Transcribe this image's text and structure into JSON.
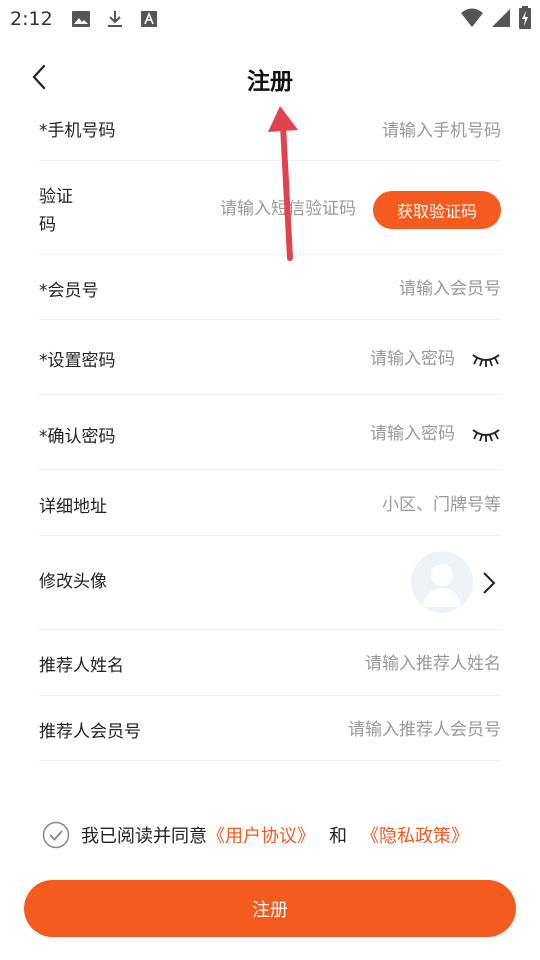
{
  "status_bar": {
    "time": "2:12",
    "left_icons": [
      "image-icon",
      "download-icon",
      "font-icon"
    ],
    "right_icons": [
      "wifi-icon",
      "signal-icon",
      "battery-charging-icon"
    ]
  },
  "header": {
    "title": "注册"
  },
  "form": {
    "phone": {
      "label": "*手机号码",
      "placeholder": "请输入手机号码"
    },
    "sms_code": {
      "label_line1": "验证",
      "label_line2": "码",
      "placeholder": "请输入短信验证码",
      "button": "获取验证码"
    },
    "member_no": {
      "label": "*会员号",
      "placeholder": "请输入会员号"
    },
    "password": {
      "label": "*设置密码",
      "placeholder": "请输入密码"
    },
    "confirm_password": {
      "label": "*确认密码",
      "placeholder": "请输入密码"
    },
    "address": {
      "label": "详细地址",
      "placeholder": "小区、门牌号等"
    },
    "avatar": {
      "label": "修改头像"
    },
    "referrer_name": {
      "label": "推荐人姓名",
      "placeholder": "请输入推荐人姓名"
    },
    "referrer_no": {
      "label": "推荐人会员号",
      "placeholder": "请输入推荐人会员号"
    }
  },
  "agreement": {
    "prefix": "我已阅读并同意",
    "user_agreement": "《用户协议》",
    "and": "和",
    "privacy_policy": "《隐私政策》"
  },
  "submit": {
    "label": "注册"
  },
  "colors": {
    "accent": "#f55a1e",
    "annotation": "#e0434f"
  }
}
